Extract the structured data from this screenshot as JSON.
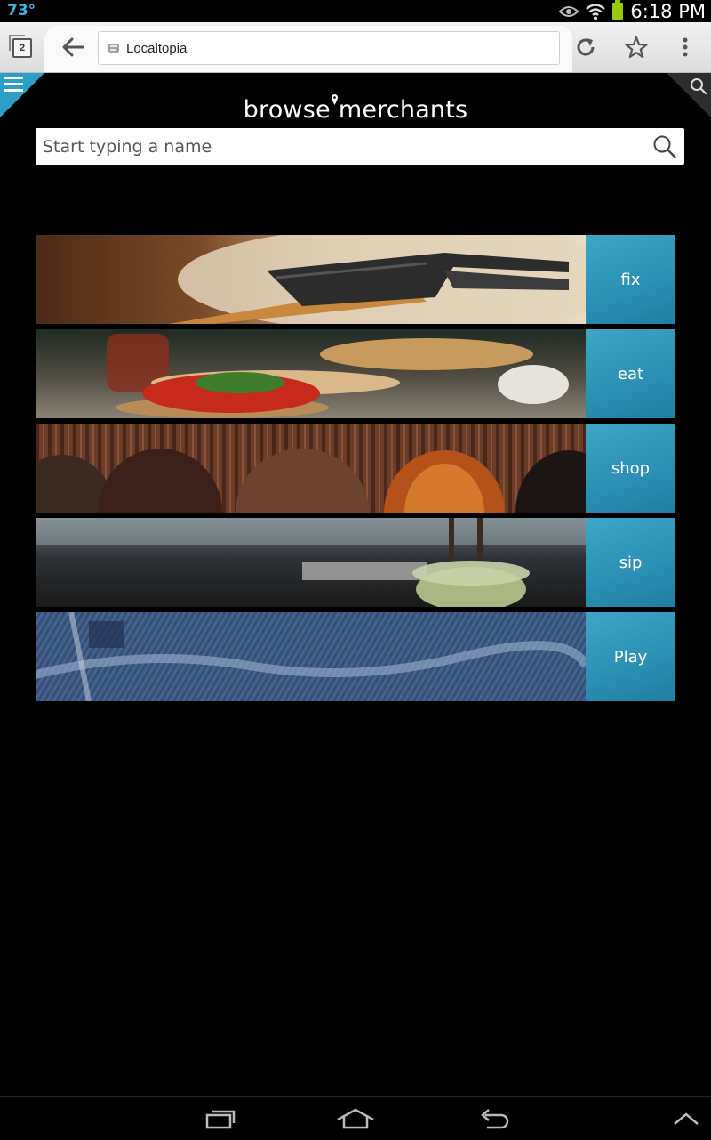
{
  "status_bar": {
    "temperature": "73°",
    "time": "6:18 PM",
    "icons": [
      "eye-icon",
      "wifi-icon",
      "battery-icon"
    ],
    "battery_color": "#99cc00",
    "temp_color": "#33b5e5"
  },
  "browser": {
    "tab_count": "2",
    "url_title": "Localtopia",
    "icons": [
      "back-arrow-icon",
      "reload-icon",
      "star-icon",
      "overflow-menu-icon"
    ]
  },
  "page": {
    "brand_left": "browse",
    "brand_right": "merchants",
    "search_placeholder": "Start typing a name",
    "accent_color": "#2b9fc4",
    "categories": [
      {
        "label": "fix",
        "photo": "hammer"
      },
      {
        "label": "eat",
        "photo": "tomato-bruschetta"
      },
      {
        "label": "shop",
        "photo": "leather-shoes"
      },
      {
        "label": "sip",
        "photo": "smoothie-cup"
      },
      {
        "label": "Play",
        "photo": "denim-jeans"
      }
    ]
  },
  "nav_bar": {
    "icons": [
      "recent-apps-icon",
      "home-icon",
      "back-icon",
      "collapse-chevron-icon"
    ]
  }
}
